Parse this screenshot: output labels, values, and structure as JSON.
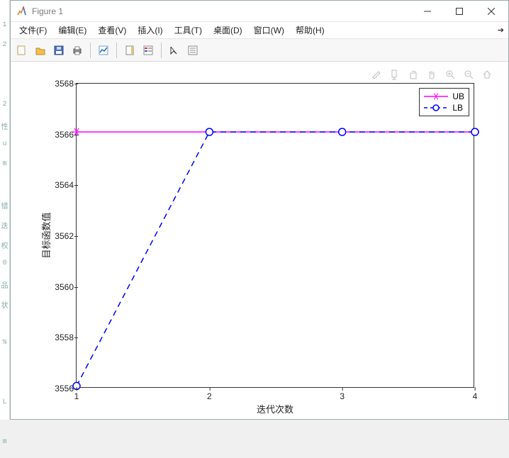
{
  "window": {
    "title": "Figure 1",
    "min_tooltip": "Minimize",
    "max_tooltip": "Maximize",
    "close_tooltip": "Close"
  },
  "menu": {
    "items": [
      "文件(F)",
      "编辑(E)",
      "查看(V)",
      "插入(I)",
      "工具(T)",
      "桌面(D)",
      "窗口(W)",
      "帮助(H)"
    ]
  },
  "toolbar": {
    "new": "New Figure",
    "open": "Open",
    "save": "Save",
    "print": "Print",
    "link": "Link Plot",
    "insert_colorbar": "Insert Colorbar",
    "insert_legend": "Insert Legend",
    "edit": "Edit Plot",
    "open_props": "Open Property Inspector"
  },
  "axes_toolbar": {
    "brush": "Brush",
    "datatips": "Data Tips",
    "rotate": "Rotate",
    "pan": "Pan",
    "zoomin": "Zoom In",
    "zoomout": "Zoom Out",
    "home": "Restore View"
  },
  "legend": {
    "items": [
      "UB",
      "LB"
    ]
  },
  "chart_data": {
    "type": "line",
    "xlabel": "迭代次数",
    "ylabel": "目标函数值",
    "xlim": [
      1,
      4
    ],
    "ylim": [
      3556,
      3568
    ],
    "xticks": [
      1,
      2,
      3,
      4
    ],
    "yticks": [
      3556,
      3558,
      3560,
      3562,
      3564,
      3566,
      3568
    ],
    "x": [
      1,
      2,
      3,
      4
    ],
    "series": [
      {
        "name": "UB",
        "values": [
          3566.1,
          3566.1,
          3566.1,
          3566.1
        ],
        "color": "#ff00ff",
        "marker": "star",
        "line": "solid"
      },
      {
        "name": "LB",
        "values": [
          3556.1,
          3566.1,
          3566.1,
          3566.1
        ],
        "color": "#0000ff",
        "marker": "circle",
        "line": "dashed"
      }
    ]
  },
  "gutter": [
    "1",
    "2",
    "",
    "",
    "2",
    "性",
    "u",
    "m",
    "",
    "错",
    "迭",
    "权",
    "0",
    "品",
    "状",
    "",
    "%",
    "",
    "",
    "L",
    "",
    "m"
  ]
}
